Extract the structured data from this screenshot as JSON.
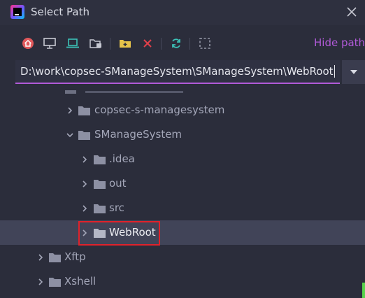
{
  "window": {
    "title": "Select Path"
  },
  "toolbar": {
    "buttons": [
      {
        "name": "home-icon",
        "color": "#e0585b"
      },
      {
        "name": "desktop-icon",
        "color": "#c7c9d3"
      },
      {
        "name": "laptop-icon",
        "color": "#3cc2b8"
      },
      {
        "name": "project-folder-icon",
        "color": "#c7c9d3"
      },
      {
        "name": "new-folder-icon",
        "color": "#e6c34a"
      },
      {
        "name": "delete-icon",
        "color": "#e0404a"
      },
      {
        "name": "refresh-icon",
        "color": "#3cc2b8"
      },
      {
        "name": "select-area-icon",
        "color": "#9396a6"
      }
    ],
    "hide_path_label": "Hide path"
  },
  "path": {
    "value": "D:\\work\\copsec-SManageSystem\\SManageSystem\\WebRoot"
  },
  "tree": {
    "items": [
      {
        "label": "copsec-s-managesystem",
        "expanded": false
      },
      {
        "label": "SManageSystem",
        "expanded": true
      },
      {
        "label": ".idea",
        "expanded": false
      },
      {
        "label": "out",
        "expanded": false
      },
      {
        "label": "src",
        "expanded": false
      },
      {
        "label": "WebRoot",
        "expanded": false,
        "selected": true
      },
      {
        "label": "Xftp",
        "expanded": false
      },
      {
        "label": "Xshell",
        "expanded": false
      }
    ]
  },
  "colors": {
    "accent": "#b15ad8",
    "selection_highlight": "#e0222b",
    "folder": "#8d90a3"
  }
}
